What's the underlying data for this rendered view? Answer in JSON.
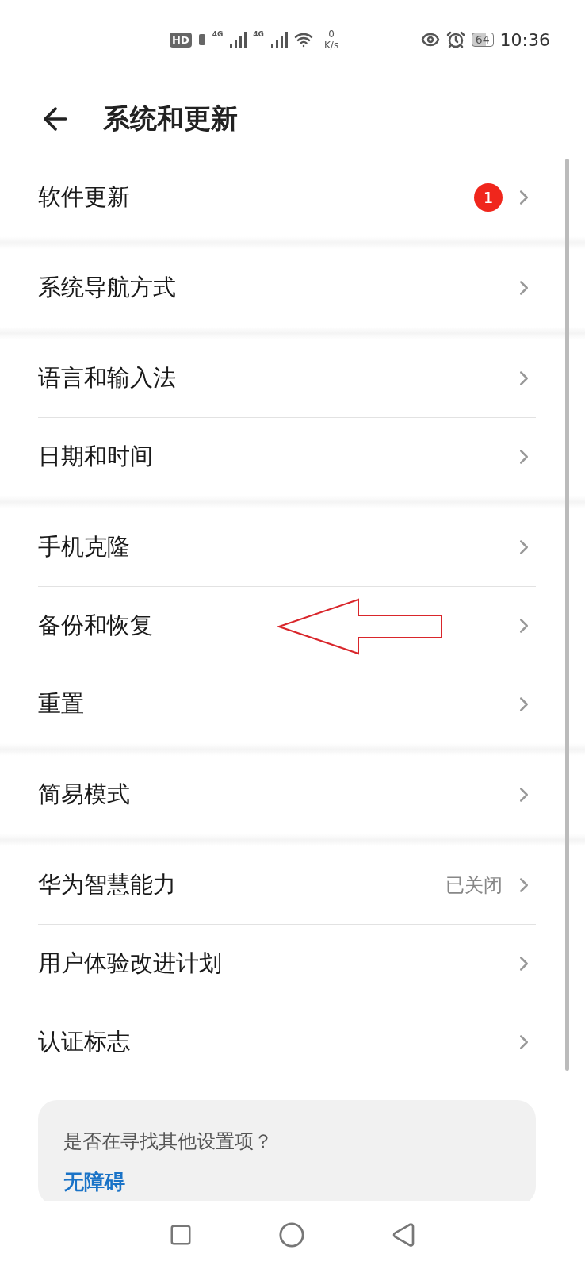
{
  "status_bar": {
    "hd": "HD",
    "network_1": "4G",
    "network_2": "4G",
    "speed_value": "0",
    "speed_unit": "K/s",
    "battery": "64",
    "time": "10:36"
  },
  "header": {
    "title": "系统和更新"
  },
  "groups": [
    {
      "rows": [
        {
          "label": "软件更新",
          "badge": "1",
          "annotated": false
        }
      ]
    },
    {
      "rows": [
        {
          "label": "系统导航方式",
          "annotated": false
        }
      ]
    },
    {
      "rows": [
        {
          "label": "语言和输入法",
          "annotated": false
        },
        {
          "label": "日期和时间",
          "annotated": false
        }
      ]
    },
    {
      "rows": [
        {
          "label": "手机克隆",
          "annotated": false
        },
        {
          "label": "备份和恢复",
          "annotated": true
        },
        {
          "label": "重置",
          "annotated": false
        }
      ]
    },
    {
      "rows": [
        {
          "label": "简易模式",
          "annotated": false
        }
      ]
    },
    {
      "rows": [
        {
          "label": "华为智慧能力",
          "value": "已关闭",
          "annotated": false
        },
        {
          "label": "用户体验改进计划",
          "annotated": false
        },
        {
          "label": "认证标志",
          "annotated": false
        }
      ]
    }
  ],
  "suggestion_card": {
    "question": "是否在寻找其他设置项？",
    "link": "无障碍"
  }
}
